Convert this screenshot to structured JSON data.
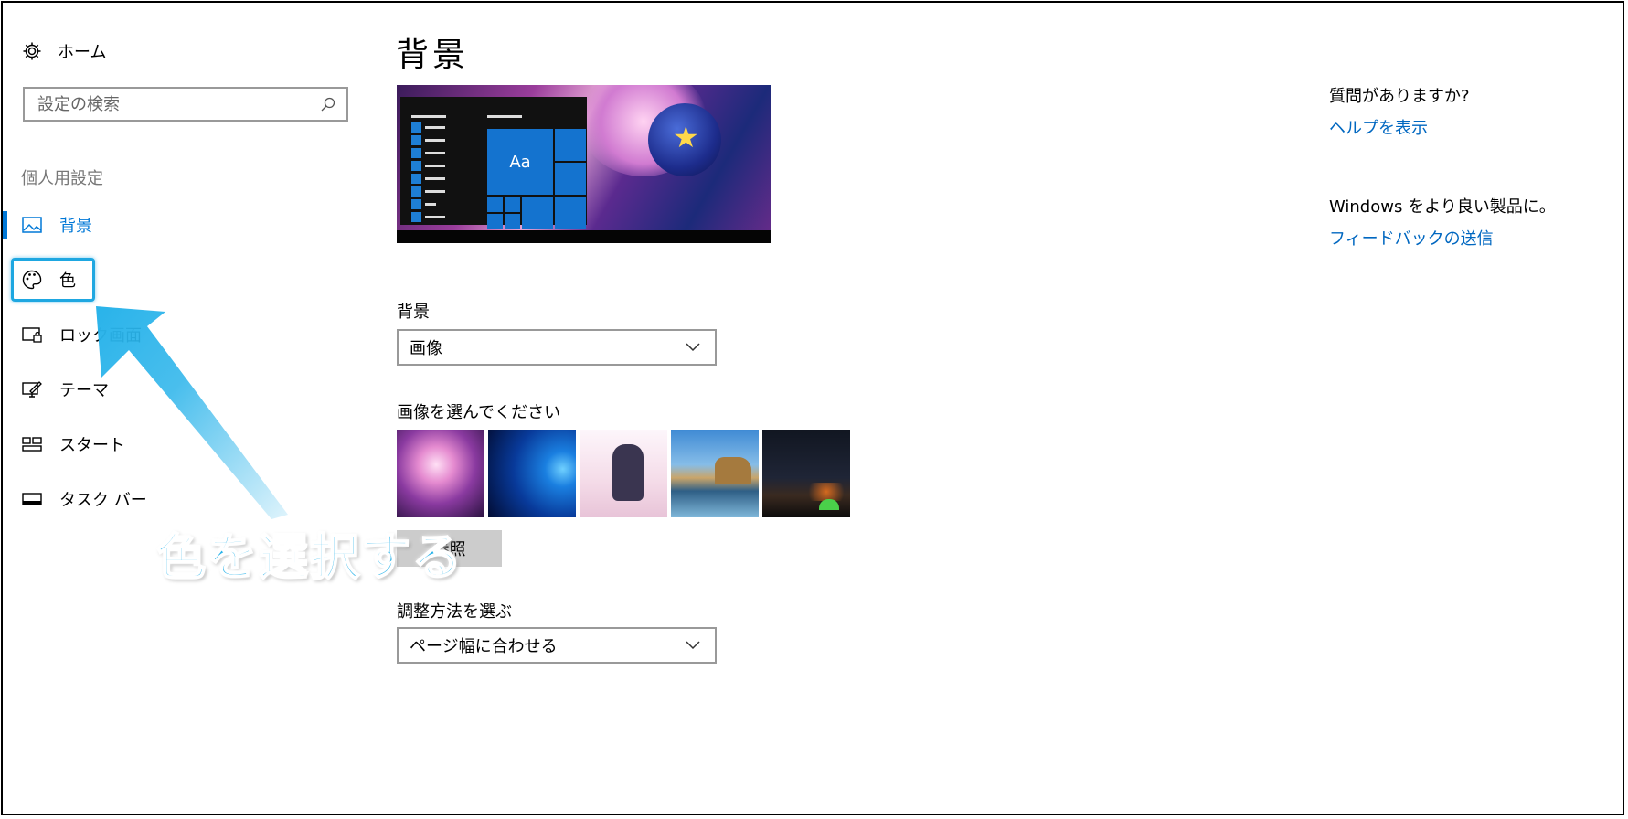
{
  "sidebar": {
    "home_label": "ホーム",
    "search_placeholder": "設定の検索",
    "section_label": "個人用設定",
    "items": [
      {
        "label": "背景",
        "icon": "picture-icon",
        "active": true
      },
      {
        "label": "色",
        "icon": "palette-icon"
      },
      {
        "label": "ロック画面",
        "icon": "lock-screen-icon"
      },
      {
        "label": "テーマ",
        "icon": "theme-icon"
      },
      {
        "label": "スタート",
        "icon": "start-icon"
      },
      {
        "label": "タスク バー",
        "icon": "taskbar-icon"
      }
    ]
  },
  "main": {
    "title": "背景",
    "preview_tile_text": "Aa",
    "background_label": "背景",
    "background_value": "画像",
    "choose_image_label": "画像を選んでください",
    "browse_label": "参照",
    "fit_label": "調整方法を選ぶ",
    "fit_value": "ページ幅に合わせる"
  },
  "right": {
    "question": "質問がありますか?",
    "help_link": "ヘルプを表示",
    "feedback_prompt": "Windows をより良い製品に。",
    "feedback_link": "フィードバックの送信"
  },
  "annotation": {
    "callout_text": "色を選択する"
  },
  "colors": {
    "accent": "#0078d7",
    "link": "#0067c0",
    "highlight": "#1ea7e1"
  }
}
